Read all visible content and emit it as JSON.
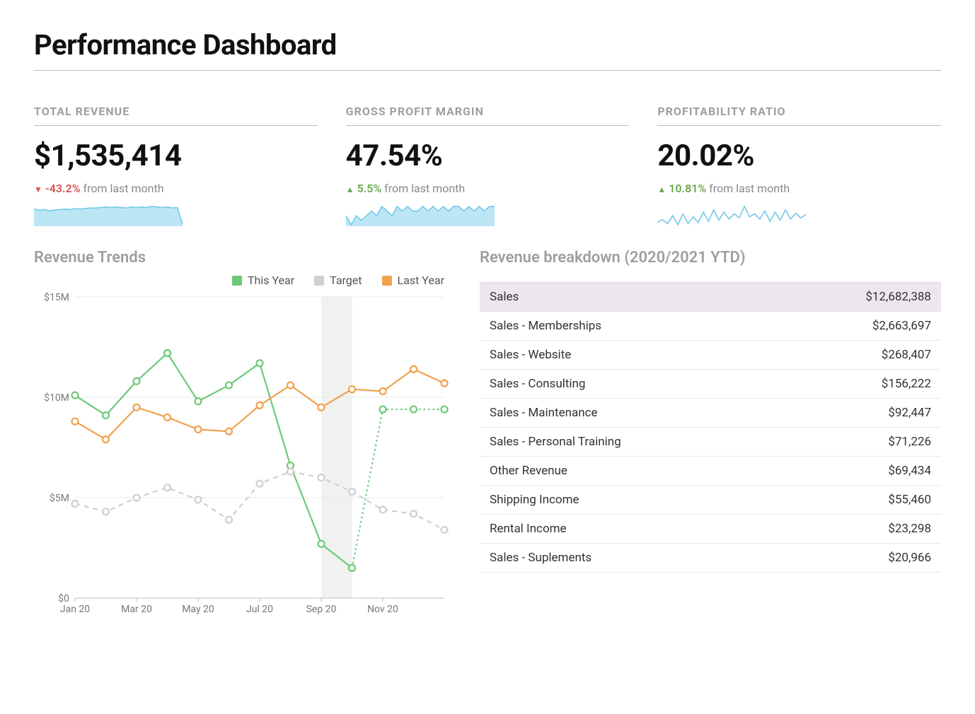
{
  "page": {
    "title": "Performance Dashboard"
  },
  "kpis": [
    {
      "label": "TOTAL REVENUE",
      "value": "$1,535,414",
      "deltaDirection": "down",
      "deltaValue": "-43.2%",
      "deltaSuffix": " from last month",
      "sparklineType": "area",
      "sparkline": [
        48,
        46,
        47,
        45,
        46,
        47,
        48,
        47,
        49,
        48,
        49,
        50,
        50,
        51,
        52,
        51,
        52,
        51,
        50,
        52,
        51,
        52,
        51,
        53,
        52,
        51,
        52,
        50,
        51,
        18
      ]
    },
    {
      "label": "GROSS PROFIT MARGIN",
      "value": "47.54%",
      "deltaDirection": "up",
      "deltaValue": "5.5%",
      "deltaSuffix": " from last month",
      "sparklineType": "area",
      "sparkline": [
        50,
        48,
        50,
        49,
        50,
        51,
        50,
        52,
        51,
        50,
        52,
        51,
        52,
        51,
        51,
        52,
        51,
        52,
        51,
        52,
        51,
        52,
        52,
        51,
        52,
        51,
        52,
        51,
        52,
        52
      ]
    },
    {
      "label": "PROFITABILITY RATIO",
      "value": "20.02%",
      "deltaDirection": "up",
      "deltaValue": "10.81%",
      "deltaSuffix": " from last month",
      "sparklineType": "line",
      "sparkline": [
        40,
        45,
        38,
        52,
        36,
        55,
        38,
        50,
        40,
        58,
        42,
        62,
        44,
        58,
        46,
        55,
        48,
        68,
        50,
        55,
        46,
        60,
        42,
        58,
        44,
        62,
        46,
        56,
        48,
        54
      ]
    }
  ],
  "revenueTrends": {
    "title": "Revenue Trends",
    "legend": [
      {
        "name": "This Year",
        "color": "#6cc978"
      },
      {
        "name": "Target",
        "color": "#cfcfcf"
      },
      {
        "name": "Last Year",
        "color": "#f0a14e"
      }
    ]
  },
  "breakdown": {
    "title": "Revenue breakdown (2020/2021 YTD)",
    "rows": [
      {
        "label": "Sales",
        "amount": "$12,682,388",
        "header": true
      },
      {
        "label": "Sales - Memberships",
        "amount": "$2,663,697"
      },
      {
        "label": "Sales - Website",
        "amount": "$268,407"
      },
      {
        "label": "Sales - Consulting",
        "amount": "$156,222"
      },
      {
        "label": "Sales - Maintenance",
        "amount": "$92,447"
      },
      {
        "label": "Sales - Personal Training",
        "amount": "$71,226"
      },
      {
        "label": "Other Revenue",
        "amount": "$69,434"
      },
      {
        "label": "Shipping Income",
        "amount": "$55,460"
      },
      {
        "label": "Rental Income",
        "amount": "$23,298"
      },
      {
        "label": "Sales - Suplements",
        "amount": "$20,966"
      }
    ]
  },
  "chart_data": {
    "type": "line",
    "title": "Revenue Trends",
    "ylabel": "",
    "xlabel": "",
    "ylim": [
      0,
      15
    ],
    "y_unit": "$M",
    "y_ticks": [
      0,
      5,
      10,
      15
    ],
    "x_tick_labels": [
      "Jan 20",
      "Mar 20",
      "May 20",
      "Jul 20",
      "Sep 20",
      "Nov 20"
    ],
    "categories": [
      "Jan 20",
      "Feb 20",
      "Mar 20",
      "Apr 20",
      "May 20",
      "Jun 20",
      "Jul 20",
      "Aug 20",
      "Sep 20",
      "Oct 20",
      "Nov 20",
      "Dec 20"
    ],
    "series": [
      {
        "name": "This Year",
        "color": "#6cc978",
        "values": [
          10.1,
          9.1,
          10.8,
          12.2,
          9.8,
          10.6,
          11.7,
          6.6,
          2.7,
          1.5,
          null,
          null
        ],
        "forecast_values": [
          null,
          null,
          null,
          null,
          null,
          null,
          null,
          null,
          null,
          1.5,
          9.4,
          9.4,
          9.4
        ]
      },
      {
        "name": "Target",
        "color": "#cfcfcf",
        "dashed": true,
        "values": [
          4.7,
          4.3,
          5.0,
          5.5,
          4.9,
          3.9,
          5.7,
          6.3,
          6.0,
          5.3,
          4.4,
          4.2,
          3.4
        ]
      },
      {
        "name": "Last Year",
        "color": "#f0a14e",
        "values": [
          8.8,
          7.9,
          9.5,
          9.0,
          8.4,
          8.3,
          9.6,
          10.6,
          9.5,
          10.4,
          10.3,
          11.4,
          10.7
        ]
      }
    ],
    "highlight_band": {
      "from_index": 8,
      "to_index": 9
    }
  }
}
